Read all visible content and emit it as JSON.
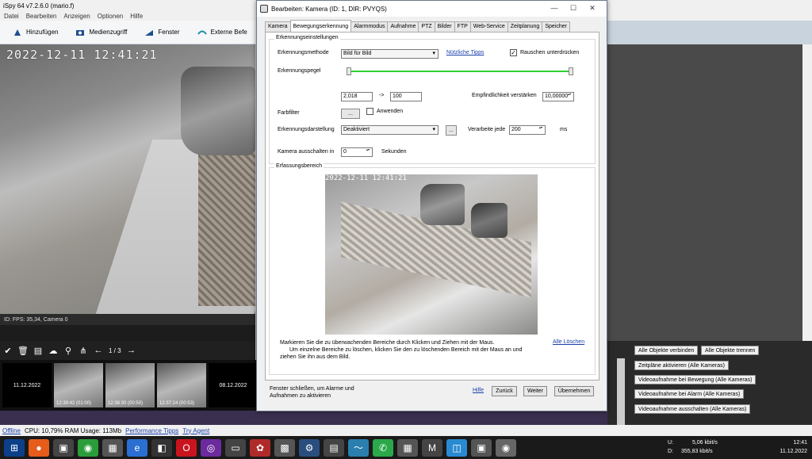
{
  "app": {
    "title": "iSpy 64 v7.2.6.0 (mario.f)",
    "menu": [
      "Datei",
      "Bearbeiten",
      "Anzeigen",
      "Optionen",
      "Hilfe"
    ],
    "toolbar": [
      "Hinzufügen",
      "Medienzugriff",
      "Fenster",
      "Externe Befe"
    ],
    "camera_timestamp": "2022-12-11  12:41:21",
    "camera_status": "ID: FPS: 35,34, Camera 0",
    "pager": "1 / 3",
    "thumbs": [
      {
        "label": "11.12.2022",
        "kind": "date"
      },
      {
        "label": "12:39:42 (01:00)",
        "kind": "clip"
      },
      {
        "label": "12:38:30 (00:50)",
        "kind": "clip"
      },
      {
        "label": "12:37:24 (00:53)",
        "kind": "clip"
      },
      {
        "label": "08.12.2022",
        "kind": "date"
      }
    ],
    "status": {
      "offline": "Offline",
      "cpu": "CPU: 10,79% RAM Usage: 113Mb",
      "perf": "Performance Tipps",
      "agent": "Try Agent"
    },
    "right_buttons": [
      "Alle Objekte verbinden",
      "Alle Objekte trennen",
      "Zeitpläne aktivieren (Alle Kameras)",
      "Videoaufnahme bei Bewegung (Alle Kameras)",
      "Videoaufnahme bei Alarm (Alle Kameras)",
      "Videoaufnahme ausschalten (Alle Kameras)"
    ]
  },
  "taskbar": {
    "net_u": "U:",
    "net_d": "D:",
    "up": "5,06 kbit/s",
    "down": "355,83 kbit/s",
    "time": "12:41",
    "date": "11.12.2022"
  },
  "dialog": {
    "title": "Bearbeiten: Kamera (ID: 1, DIR: PVYQS)",
    "tabs": [
      "Kamera",
      "Bewegungserkennung",
      "Alarmmodus",
      "Aufnahme",
      "PTZ",
      "Bilder",
      "FTP",
      "Web-Service",
      "Zeitplanung",
      "Speicher"
    ],
    "group_settings": "Erkennungseinstellungen",
    "method_label": "Erkennungsmethode",
    "method_value": "Bild für Bild",
    "tips_link": "Nützliche Tipps",
    "noise_label": "Rauschen unterdrücken",
    "level_label": "Erkennungspegel",
    "min_value": "2,018",
    "arrow": "->",
    "max_value": "100",
    "gain_label": "Empfindlichkeit verstärken",
    "gain_value": "10,00000",
    "color_filter_label": "Farbfilter",
    "color_btn": "...",
    "apply_label": "Anwenden",
    "display_label": "Erkennungsdarstellung",
    "display_value": "Deaktiviert",
    "display_btn": "...",
    "process_label": "Verarbeite jede",
    "process_value": "200",
    "process_unit": "ms",
    "off_label": "Kamera ausschalten in",
    "off_value": "0",
    "off_unit": "Sekunden",
    "group_area": "Erfassungsbereich",
    "preview_time": "2022-12-11  12:41:21",
    "note1": "Markieren Sie die zu überwachenden Bereiche durch Klicken und Ziehen mit der Maus.",
    "note2": "Um einzelne Bereiche zu löschen, klicken Sie den zu löschenden Bereich mit der Maus an und",
    "note3": "ziehen Sie ihn aus dem Bild.",
    "clear_all": "Alle Löschen",
    "footer_note1": "Fenster schließen, um Alarme und",
    "footer_note2": "Aufnahmen zu aktivieren",
    "help": "Hilfe",
    "back": "Zurück",
    "next": "Weiter",
    "accept": "Übernehmen"
  }
}
